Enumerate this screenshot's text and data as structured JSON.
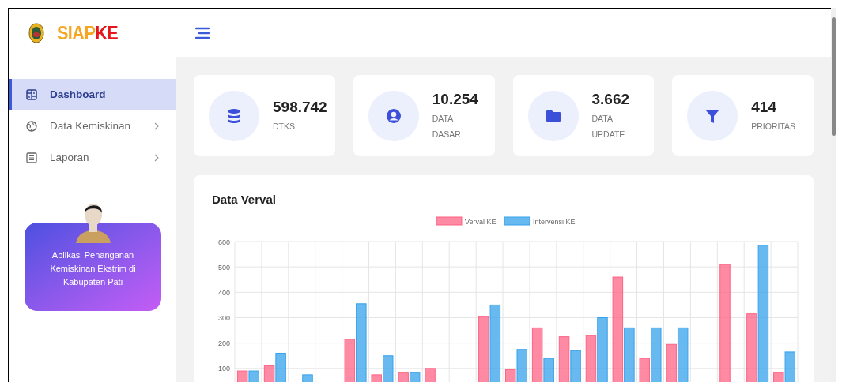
{
  "brand": {
    "prefix": "SIAP",
    "suffix": "KE"
  },
  "sidebar": {
    "items": [
      {
        "label": "Dashboard",
        "selected": true,
        "has_submenu": false
      },
      {
        "label": "Data Kemiskinan",
        "selected": false,
        "has_submenu": true
      },
      {
        "label": "Laporan",
        "selected": false,
        "has_submenu": true
      }
    ],
    "promo": {
      "text": "Aplikasi Penanganan Kemiskinan Ekstrim di Kabupaten Pati"
    }
  },
  "stats": [
    {
      "value": "598.742",
      "label": "DTKS"
    },
    {
      "value": "10.254",
      "label": "DATA DASAR"
    },
    {
      "value": "3.662",
      "label": "DATA UPDATE"
    },
    {
      "value": "414",
      "label": "PRIORITAS"
    }
  ],
  "chart_card": {
    "title": "Data Verval",
    "chart_data": {
      "type": "bar",
      "ylim": [
        0,
        600
      ],
      "yticks": [
        100,
        200,
        300,
        400,
        500,
        600
      ],
      "grid": true,
      "legend": true,
      "series": [
        {
          "name": "Verval KE",
          "color": "#ff6384",
          "values": [
            90,
            110,
            null,
            null,
            215,
            75,
            85,
            100,
            null,
            305,
            95,
            260,
            225,
            230,
            460,
            140,
            195,
            null,
            510,
            315,
            85
          ]
        },
        {
          "name": "Intervensi KE",
          "color": "#36a2eb",
          "values": [
            90,
            160,
            75,
            null,
            355,
            150,
            85,
            null,
            null,
            350,
            175,
            140,
            170,
            300,
            260,
            260,
            260,
            null,
            null,
            585,
            165
          ]
        }
      ]
    }
  }
}
